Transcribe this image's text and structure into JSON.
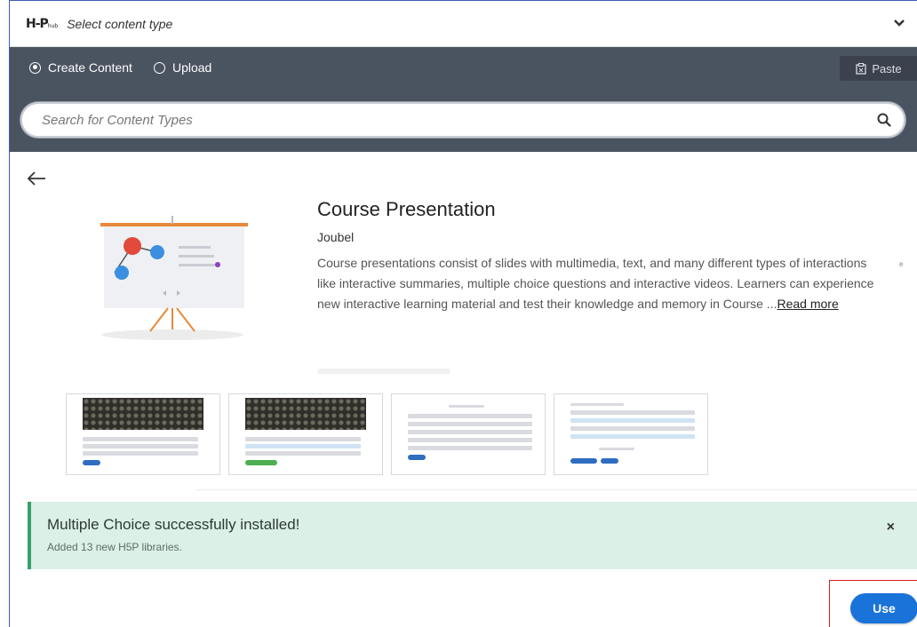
{
  "hub": {
    "logo": "H-P",
    "logo_small": "hub",
    "title": "Select content type"
  },
  "tabs": [
    {
      "label": "Create Content",
      "selected": true
    },
    {
      "label": "Upload",
      "selected": false
    }
  ],
  "paste_label": "Paste",
  "search": {
    "placeholder": "Search for Content Types"
  },
  "content_type": {
    "title": "Course Presentation",
    "owner": "Joubel",
    "description": "Course presentations consist of slides with multimedia, text, and many different types of interactions like interactive summaries, multiple choice questions and interactive videos. Learners can experience new interactive learning material and test their knowledge and memory in Course ...",
    "read_more": "Read more"
  },
  "stray_char": "e",
  "notice": {
    "title": "Multiple Choice successfully installed!",
    "subtitle": "Added 13 new H5P libraries.",
    "close": "×"
  },
  "use_label": "Use",
  "colors": {
    "tabbar": "#4a5360",
    "accent": "#1a73d9",
    "success_bg": "#dbf0e6",
    "success_border": "#38a169",
    "highlight": "#d81b1b"
  }
}
